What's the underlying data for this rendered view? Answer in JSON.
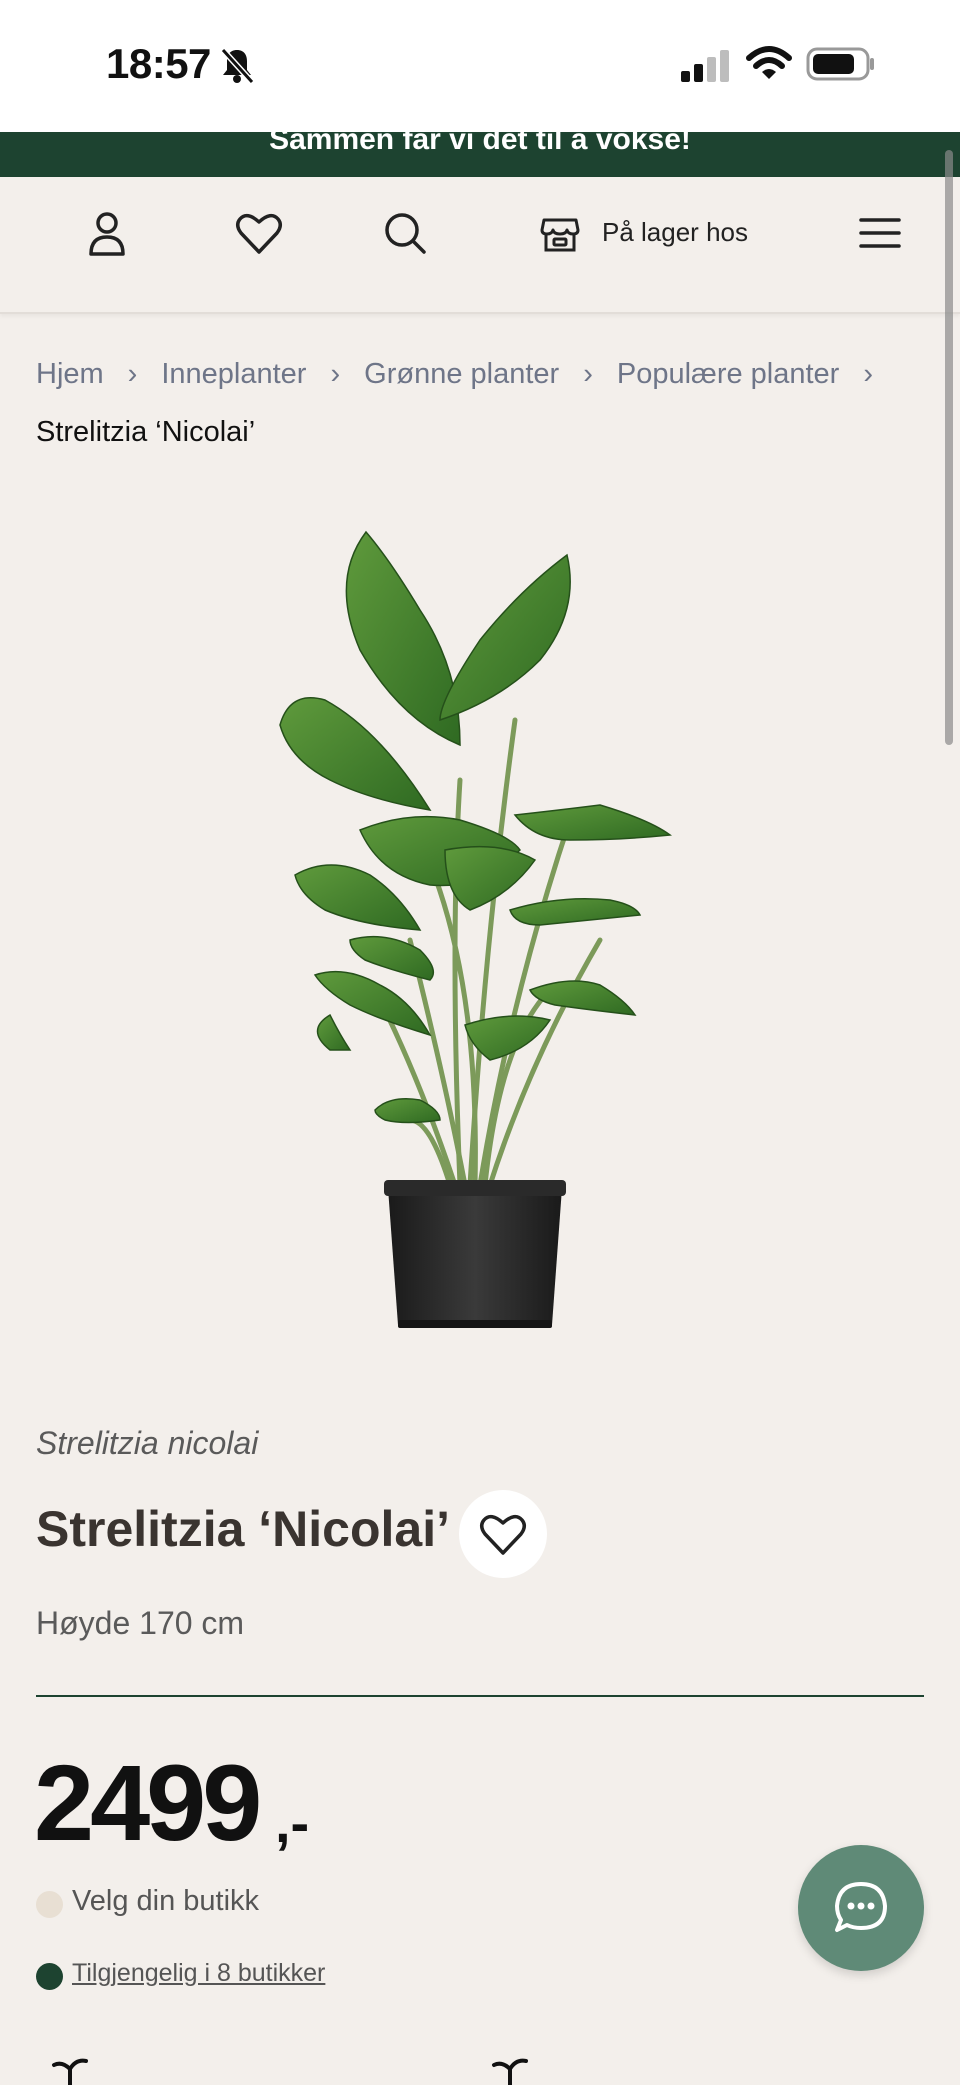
{
  "status_bar": {
    "time": "18:57",
    "icons": [
      "bell-slash-icon",
      "signal-icon",
      "wifi-icon",
      "battery-icon"
    ]
  },
  "banner": {
    "text": "Sammen får vi det til å vokse!"
  },
  "header": {
    "icons": [
      "user-icon",
      "heart-icon",
      "search-icon",
      "store-icon",
      "menu-icon"
    ],
    "store_label": "På lager hos"
  },
  "breadcrumb": {
    "items": [
      "Hjem",
      "Inneplanter",
      "Grønne planter",
      "Populære planter"
    ],
    "current": "Strelitzia ‘Nicolai’"
  },
  "product": {
    "latin_name": "Strelitzia nicolai",
    "title": "Strelitzia ‘Nicolai’",
    "height": "Høyde 170 cm",
    "price": "2499",
    "price_suffix": ",-",
    "store_select": "Velg din butikk",
    "availability": "Tilgjengelig i 8 butikker",
    "image": "plant-in-pot-image"
  },
  "colors": {
    "brand_green": "#1d4330",
    "background": "#f3efeb",
    "chat_button": "#5f8a77",
    "available_dot": "#1d4330",
    "store_dot": "#e8dfd3"
  },
  "chat": {
    "icon": "chat-bubble-icon"
  }
}
